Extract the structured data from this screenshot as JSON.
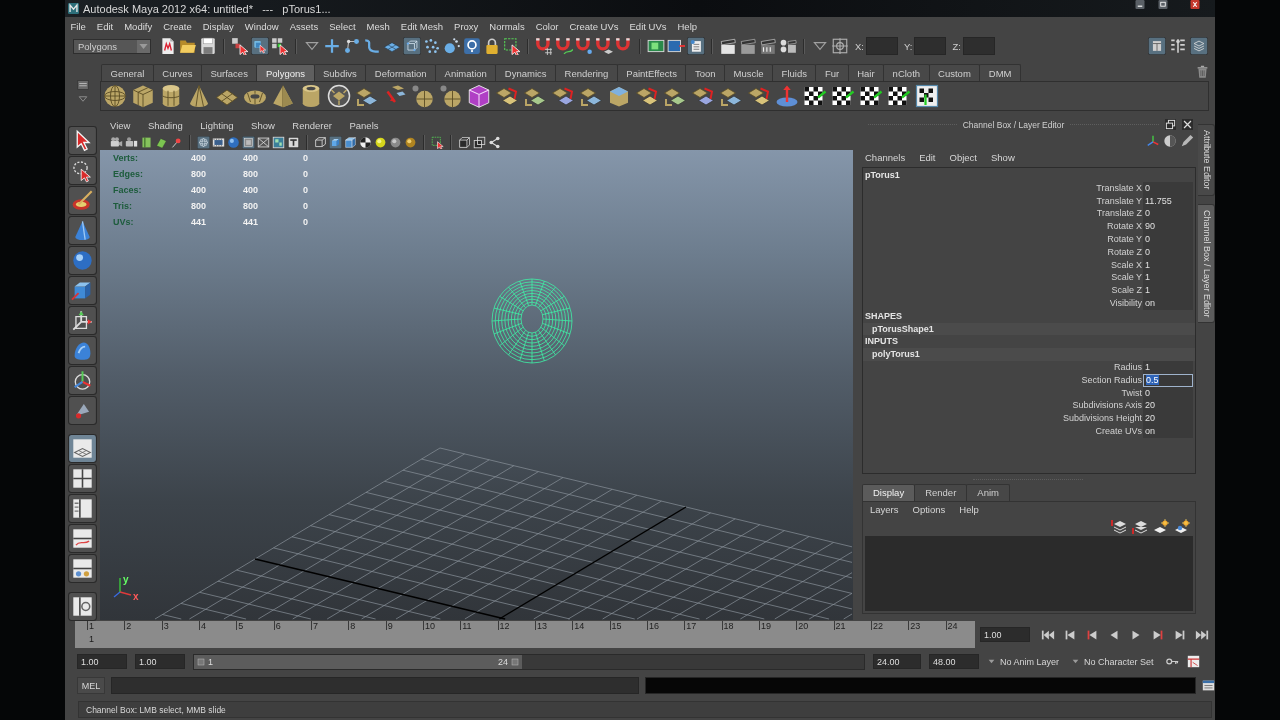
{
  "window": {
    "title": "Autodesk Maya 2012 x64: untitled*   ---   pTorus1..."
  },
  "menu_bar": [
    "File",
    "Edit",
    "Modify",
    "Create",
    "Display",
    "Window",
    "Assets",
    "Select",
    "Mesh",
    "Edit Mesh",
    "Proxy",
    "Normals",
    "Color",
    "Create UVs",
    "Edit UVs",
    "Help"
  ],
  "status_line": {
    "menu_set": "Polygons",
    "input_labels": [
      "X:",
      "Y:",
      "Z:"
    ]
  },
  "shelf": {
    "tabs": [
      {
        "label": "General",
        "selected": false
      },
      {
        "label": "Curves",
        "selected": false
      },
      {
        "label": "Surfaces",
        "selected": false
      },
      {
        "label": "Polygons",
        "selected": true
      },
      {
        "label": "Subdivs",
        "selected": false
      },
      {
        "label": "Deformation",
        "selected": false
      },
      {
        "label": "Animation",
        "selected": false
      },
      {
        "label": "Dynamics",
        "selected": false
      },
      {
        "label": "Rendering",
        "selected": false
      },
      {
        "label": "PaintEffects",
        "selected": false
      },
      {
        "label": "Toon",
        "selected": false
      },
      {
        "label": "Muscle",
        "selected": false
      },
      {
        "label": "Fluids",
        "selected": false
      },
      {
        "label": "Fur",
        "selected": false
      },
      {
        "label": "Hair",
        "selected": false
      },
      {
        "label": "nCloth",
        "selected": false
      },
      {
        "label": "Custom",
        "selected": false
      },
      {
        "label": "DMM",
        "selected": false
      }
    ]
  },
  "viewport": {
    "menu": [
      "View",
      "Shading",
      "Lighting",
      "Show",
      "Renderer",
      "Panels"
    ],
    "hud": [
      {
        "label": "Verts:",
        "values": [
          "400",
          "400",
          "0"
        ]
      },
      {
        "label": "Edges:",
        "values": [
          "800",
          "800",
          "0"
        ]
      },
      {
        "label": "Faces:",
        "values": [
          "400",
          "400",
          "0"
        ]
      },
      {
        "label": "Tris:",
        "values": [
          "800",
          "800",
          "0"
        ]
      },
      {
        "label": "UVs:",
        "values": [
          "441",
          "441",
          "0"
        ]
      }
    ],
    "axis_labels": [
      "y",
      "x"
    ]
  },
  "channel_box": {
    "title": "Channel Box / Layer Editor",
    "menu": [
      "Channels",
      "Edit",
      "Object",
      "Show"
    ],
    "object": "pTorus1",
    "attributes": [
      {
        "name": "Translate X",
        "value": "0",
        "selected": false
      },
      {
        "name": "Translate Y",
        "value": "11.755",
        "selected": false
      },
      {
        "name": "Translate Z",
        "value": "0",
        "selected": false
      },
      {
        "name": "Rotate X",
        "value": "90",
        "selected": false
      },
      {
        "name": "Rotate Y",
        "value": "0",
        "selected": false
      },
      {
        "name": "Rotate Z",
        "value": "0",
        "selected": false
      },
      {
        "name": "Scale X",
        "value": "1",
        "selected": false
      },
      {
        "name": "Scale Y",
        "value": "1",
        "selected": false
      },
      {
        "name": "Scale Z",
        "value": "1",
        "selected": false
      },
      {
        "name": "Visibility",
        "value": "on",
        "selected": false
      }
    ],
    "shapes": {
      "heading": "SHAPES",
      "node": "pTorusShape1"
    },
    "inputs": {
      "heading": "INPUTS",
      "node": "polyTorus1",
      "attributes": [
        {
          "name": "Radius",
          "value": "1",
          "selected": false
        },
        {
          "name": "Section Radius",
          "value": "0.5",
          "selected": true
        },
        {
          "name": "Twist",
          "value": "0",
          "selected": false
        },
        {
          "name": "Subdivisions Axis",
          "value": "20",
          "selected": false
        },
        {
          "name": "Subdivisions Height",
          "value": "20",
          "selected": false
        },
        {
          "name": "Create UVs",
          "value": "on",
          "selected": false
        }
      ]
    }
  },
  "side_tabs": [
    {
      "label": "Attribute Editor",
      "selected": false
    },
    {
      "label": "Channel Box / Layer Editor",
      "selected": true
    }
  ],
  "layer_editor": {
    "tabs": [
      {
        "label": "Display",
        "selected": true
      },
      {
        "label": "Render",
        "selected": false
      },
      {
        "label": "Anim",
        "selected": false
      }
    ],
    "menu": [
      "Layers",
      "Options",
      "Help"
    ]
  },
  "time_slider": {
    "frames": [
      "1",
      "2",
      "3",
      "4",
      "5",
      "6",
      "7",
      "8",
      "9",
      "10",
      "11",
      "12",
      "13",
      "14",
      "15",
      "16",
      "17",
      "18",
      "19",
      "20",
      "21",
      "22",
      "23",
      "24"
    ],
    "current_frame": "1",
    "current_time": "1.00"
  },
  "range_slider": {
    "start_time": "1.00",
    "playback_start": "1.00",
    "range_start": "1",
    "range_end": "24",
    "playback_end": "24.00",
    "end_time": "48.00",
    "anim_layer": "No Anim Layer",
    "character_set": "No Character Set"
  },
  "command_line": {
    "language": "MEL"
  },
  "help_line": {
    "text": "Channel Box: LMB select, MMB slide"
  }
}
